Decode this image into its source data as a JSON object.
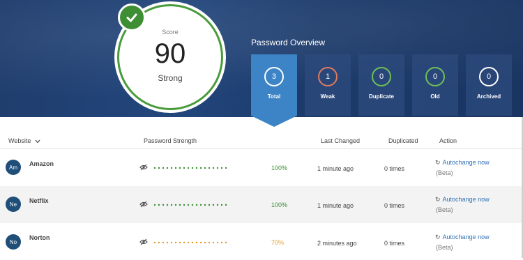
{
  "score": {
    "label": "Score",
    "value": "90",
    "rating": "Strong"
  },
  "overview": {
    "title": "Password Overview",
    "tiles": [
      {
        "count": "3",
        "label": "Total",
        "ring_color": "#ffffff"
      },
      {
        "count": "1",
        "label": "Weak",
        "ring_color": "#e07a5f"
      },
      {
        "count": "0",
        "label": "Duplicate",
        "ring_color": "#6fbf5a"
      },
      {
        "count": "0",
        "label": "Old",
        "ring_color": "#6fbf5a"
      },
      {
        "count": "0",
        "label": "Archived",
        "ring_color": "#ffffff"
      }
    ]
  },
  "table": {
    "headers": {
      "website": "Website",
      "strength": "Password Strength",
      "last_changed": "Last Changed",
      "duplicated": "Duplicated",
      "action": "Action"
    },
    "rows": [
      {
        "initials": "Am",
        "site": "Amazon",
        "strength": "100%",
        "strength_color": "#3c8f32",
        "last_changed": "1 minute ago",
        "duplicated": "0 times",
        "action": "Autochange now",
        "note": "(Beta)"
      },
      {
        "initials": "Ne",
        "site": "Netflix",
        "strength": "100%",
        "strength_color": "#3c8f32",
        "last_changed": "1 minute ago",
        "duplicated": "0 times",
        "action": "Autochange now",
        "note": "(Beta)"
      },
      {
        "initials": "No",
        "site": "Norton",
        "strength": "70%",
        "strength_color": "#e39b27",
        "last_changed": "2 minutes ago",
        "duplicated": "0 times",
        "action": "Autochange now",
        "note": "(Beta)"
      }
    ]
  },
  "colors": {
    "banner": "#1f3c6c",
    "accent": "#3d84c6",
    "score_green": "#3e8e34"
  },
  "icons": {
    "check": "check-icon",
    "hide": "eye-slash-icon",
    "refresh": "refresh-icon",
    "sort": "chevron-down-icon"
  }
}
